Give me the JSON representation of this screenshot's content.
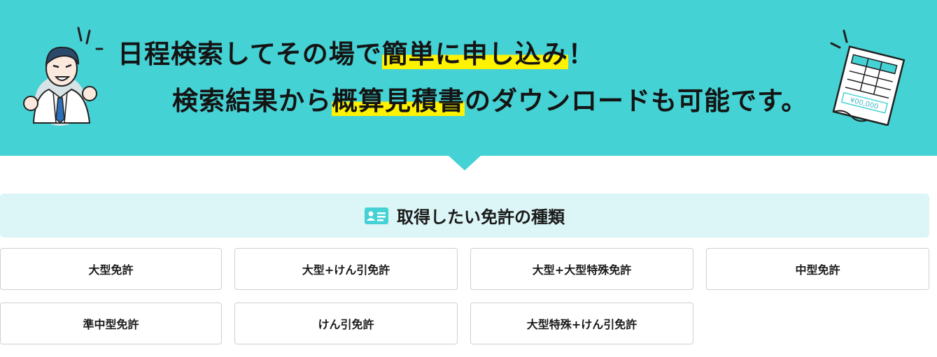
{
  "hero": {
    "line1_pre": "日程検索してその場で",
    "line1_hl": "簡単に申し込み",
    "line1_post": "！",
    "line2_pre": "検索結果から",
    "line2_hl": "概算見積書",
    "line2_post": "のダウンロードも可能です。",
    "sheet_amount": "¥00,000"
  },
  "section": {
    "title": "取得したい免許の種類"
  },
  "licenses": [
    "大型免許",
    "大型+けん引免許",
    "大型+大型特殊免許",
    "中型免許",
    "準中型免許",
    "けん引免許",
    "大型特殊+けん引免許"
  ],
  "colors": {
    "hero_bg": "#45d2d4",
    "highlight": "#fff200",
    "section_bg": "#dcf5f6",
    "icon": "#45d2d4"
  }
}
